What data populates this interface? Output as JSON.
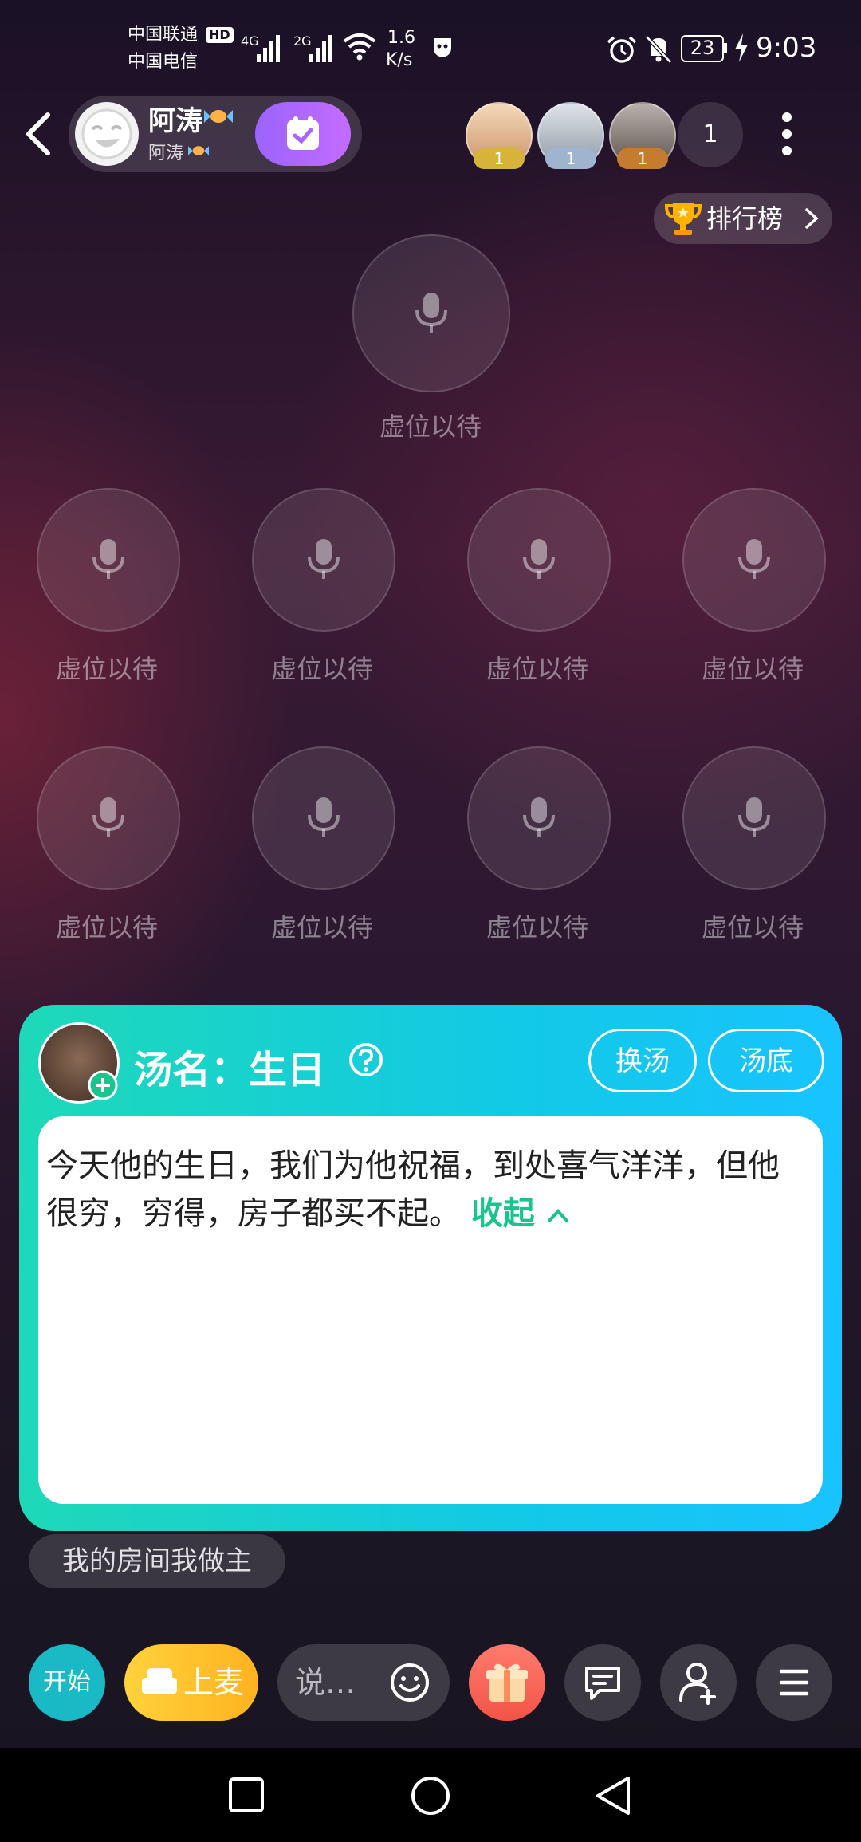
{
  "status_bar": {
    "carrier1": "中国联通",
    "carrier2": "中国电信",
    "hd": "HD",
    "net1": "4G",
    "net2": "2G",
    "speed_value": "1.6",
    "speed_unit": "K/s",
    "battery": "23",
    "time": "9:03"
  },
  "header": {
    "room_name": "阿涛",
    "room_subtitle": "阿涛",
    "viewer_badges": [
      "1",
      "1",
      "1"
    ],
    "viewer_count": "1",
    "rank_label": "排行榜"
  },
  "seats": {
    "empty_label": "虚位以待"
  },
  "soup_card": {
    "title": "汤名：生日",
    "change_btn": "换汤",
    "answer_btn": "汤底",
    "story": "今天他的生日，我们为他祝福，到处喜气洋洋，但他很穷，穷得，房子都买不起。",
    "collapse_label": "收起"
  },
  "host_chip": "我的房间我做主",
  "toolbar": {
    "start_label": "开始",
    "mic_label": "上麦",
    "input_placeholder": "说…"
  },
  "colors": {
    "card_gradient_start": "#1ed9b8",
    "card_gradient_end": "#18c3ff",
    "accent_green": "#19c48e",
    "mic_yellow": "#ffc42b",
    "gift_red": "#f25446",
    "follow_purple": "#b066ff"
  },
  "icons": [
    "back-icon",
    "check-icon",
    "trophy-icon",
    "chevron-right-icon",
    "mic-icon",
    "help-icon",
    "add-icon",
    "chevron-up-icon",
    "sofa-icon",
    "emoji-icon",
    "gift-icon",
    "message-icon",
    "add-friend-icon",
    "menu-icon",
    "more-icon",
    "square-nav-icon",
    "circle-nav-icon",
    "triangle-nav-icon"
  ]
}
